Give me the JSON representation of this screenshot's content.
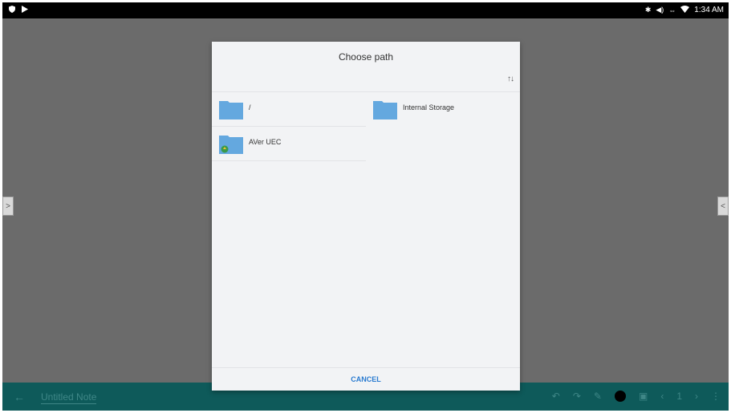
{
  "status_bar": {
    "time": "1:34 AM",
    "left_icons": [
      "shield-icon",
      "play-store-icon"
    ],
    "right_icons": [
      "bluetooth-icon",
      "volume-icon",
      "sync-icon",
      "wifi-icon"
    ]
  },
  "note": {
    "title": "Untitled Note",
    "page_number": "1"
  },
  "dialog": {
    "title": "Choose path",
    "cancel_label": "CANCEL",
    "items": [
      {
        "label": "/",
        "icon": "folder-icon"
      },
      {
        "label": "Internal Storage",
        "icon": "folder-icon"
      },
      {
        "label": "AVer UEC",
        "icon": "folder-usb-icon"
      }
    ]
  },
  "colors": {
    "folder": "#64a8df",
    "accent": "#2a7bd0",
    "toolbar": "#0e5a5a"
  }
}
